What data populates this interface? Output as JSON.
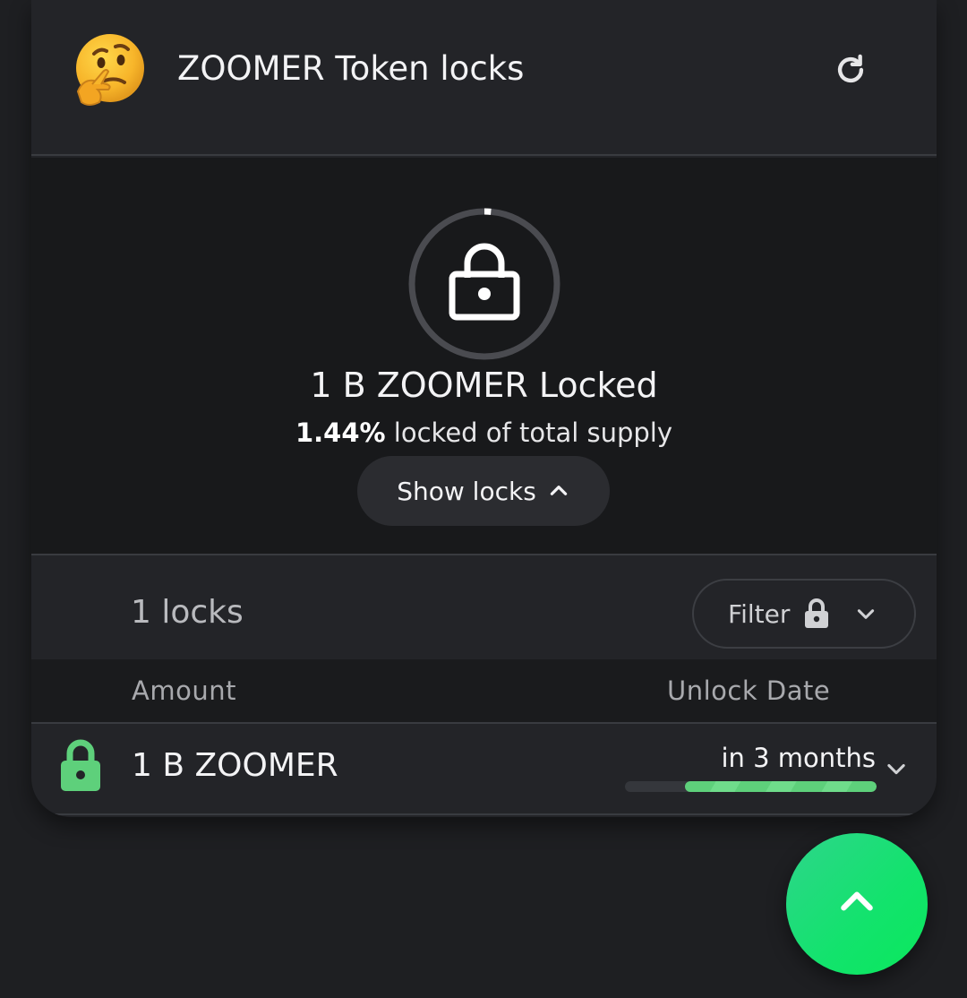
{
  "header": {
    "title": "ZOOMER Token locks",
    "emoji_icon": "thinking-face-icon",
    "refresh_icon": "refresh-icon"
  },
  "summary": {
    "locked_amount": "1 B ZOOMER Locked",
    "locked_percent": "1.44%",
    "locked_suffix": " locked of total supply",
    "locked_fraction": 0.0144,
    "show_locks_label": "Show locks"
  },
  "locks_list": {
    "count_label": "1 locks",
    "filter_label": "Filter",
    "columns": {
      "amount": "Amount",
      "unlock_date": "Unlock Date"
    },
    "rows": [
      {
        "amount": "1 B ZOOMER",
        "unlock": "in 3 months",
        "progress": 0.76,
        "status_color": "#5ed07b"
      }
    ]
  },
  "colors": {
    "accent_green": "#5ed07b",
    "fab_green": "#12e36c"
  }
}
